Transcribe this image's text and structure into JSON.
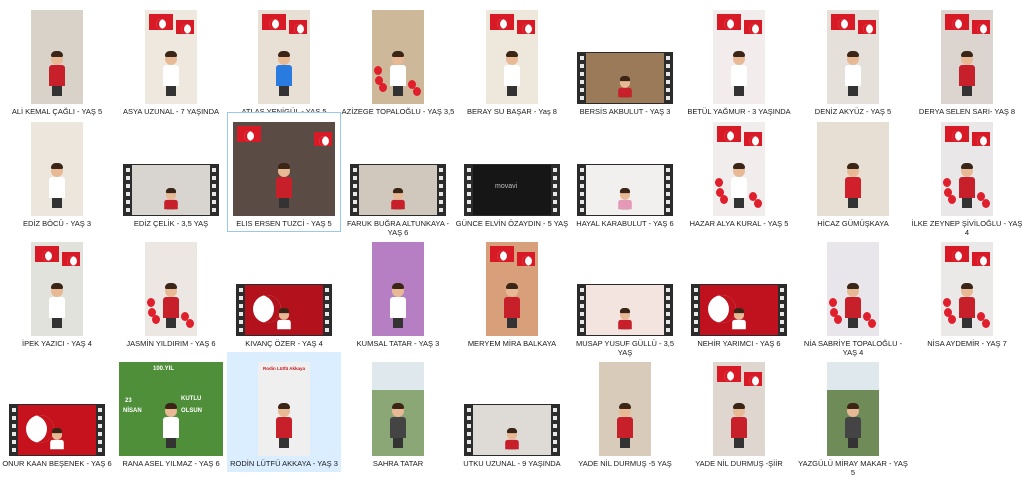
{
  "colors": {
    "selection": "#dbeeff",
    "selection_border": "#99c9f2",
    "turkish_red": "#d71a26",
    "label_text": "#1a1a1a"
  },
  "items": [
    {
      "label": "ALİ KEMAL ÇAĞLI - YAŞ 5",
      "kind": "photo"
    },
    {
      "label": "ASYA UZUNAL - 7 YAŞINDA",
      "kind": "photo"
    },
    {
      "label": "ATLAS YENİGÜL - YAŞ 5",
      "kind": "photo"
    },
    {
      "label": "AZİZEGE TOPALOĞLU - YAŞ 3,5",
      "kind": "photo"
    },
    {
      "label": "BERAY SU BAŞAR - Yaş 8",
      "kind": "photo"
    },
    {
      "label": "BERSİS AKBULUT - YAŞ 3",
      "kind": "video"
    },
    {
      "label": "BETÜL YAĞMUR - 3 YAŞINDA",
      "kind": "photo"
    },
    {
      "label": "DENİZ AKYÜZ - YAŞ 5",
      "kind": "photo"
    },
    {
      "label": "DERYA SELEN SARI- YAŞ 8",
      "kind": "photo"
    },
    {
      "label": "EDİZ BÖCÜ - YAŞ 3",
      "kind": "photo"
    },
    {
      "label": "EDİZ ÇELİK - 3,5 YAŞ",
      "kind": "video"
    },
    {
      "label": "ELIS ERSEN TUZCİ - YAŞ 5",
      "kind": "photo-wide"
    },
    {
      "label": "FARUK BUĞRA ALTUNKAYA - YAŞ 6",
      "kind": "video"
    },
    {
      "label": "GÜNCE ELVİN ÖZAYDIN - 5 YAŞ",
      "kind": "video"
    },
    {
      "label": "HAYAL KARABULUT - YAŞ 6",
      "kind": "video"
    },
    {
      "label": "HAZAR ALYA KURAL - YAŞ 5",
      "kind": "photo"
    },
    {
      "label": "HİCAZ GÜMÜŞKAYA",
      "kind": "photo-wide"
    },
    {
      "label": "İLKE ZEYNEP ŞİVİLOĞLU - YAŞ 4",
      "kind": "photo"
    },
    {
      "label": "İPEK YAZICI - YAŞ 4",
      "kind": "photo"
    },
    {
      "label": "JASMİN YILDIRIM - YAŞ 6",
      "kind": "photo"
    },
    {
      "label": "KIVANÇ ÖZER - YAŞ 4",
      "kind": "video"
    },
    {
      "label": "KUMSAL TATAR - YAŞ 3",
      "kind": "photo"
    },
    {
      "label": "MERYEM MİRA BALKAYA",
      "kind": "photo"
    },
    {
      "label": "MUSAP YUSUF GÜLLÜ - 3,5 YAŞ",
      "kind": "video"
    },
    {
      "label": "NEHİR YARIMCI - YAŞ 6",
      "kind": "video"
    },
    {
      "label": "NİA SABRİYE TOPALOĞLU - YAŞ 4",
      "kind": "photo"
    },
    {
      "label": "NİSA AYDEMİR - YAŞ 7",
      "kind": "photo"
    },
    {
      "label": "ONUR KAAN BEŞENEK - YAŞ 6",
      "kind": "video"
    },
    {
      "label": "RANA ASEL YILMAZ - YAŞ 6",
      "kind": "photo-wide"
    },
    {
      "label": "RODİN LÜTFÜ AKKAYA - YAŞ 3",
      "kind": "photo"
    },
    {
      "label": "SAHRA TATAR",
      "kind": "photo"
    },
    {
      "label": "UTKU UZUNAL - 9 YAŞINDA",
      "kind": "video"
    },
    {
      "label": "YADE NİL DURMUŞ -5 YAŞ",
      "kind": "photo"
    },
    {
      "label": "YADE NİL DURMUŞ -ŞİİR",
      "kind": "photo"
    },
    {
      "label": "YAZGÜLÜ MİRAY MAKAR - YAŞ 5",
      "kind": "photo"
    }
  ],
  "signs": {
    "rana_line1": "100.YIL",
    "rana_line2": "23",
    "rana_line3": "NİSAN",
    "rana_line4": "KUTLU",
    "rana_line5": "OLSUN",
    "rodin_sign": "Rodin Lütfü Akkaya",
    "gunce_watermark": "movavi"
  }
}
